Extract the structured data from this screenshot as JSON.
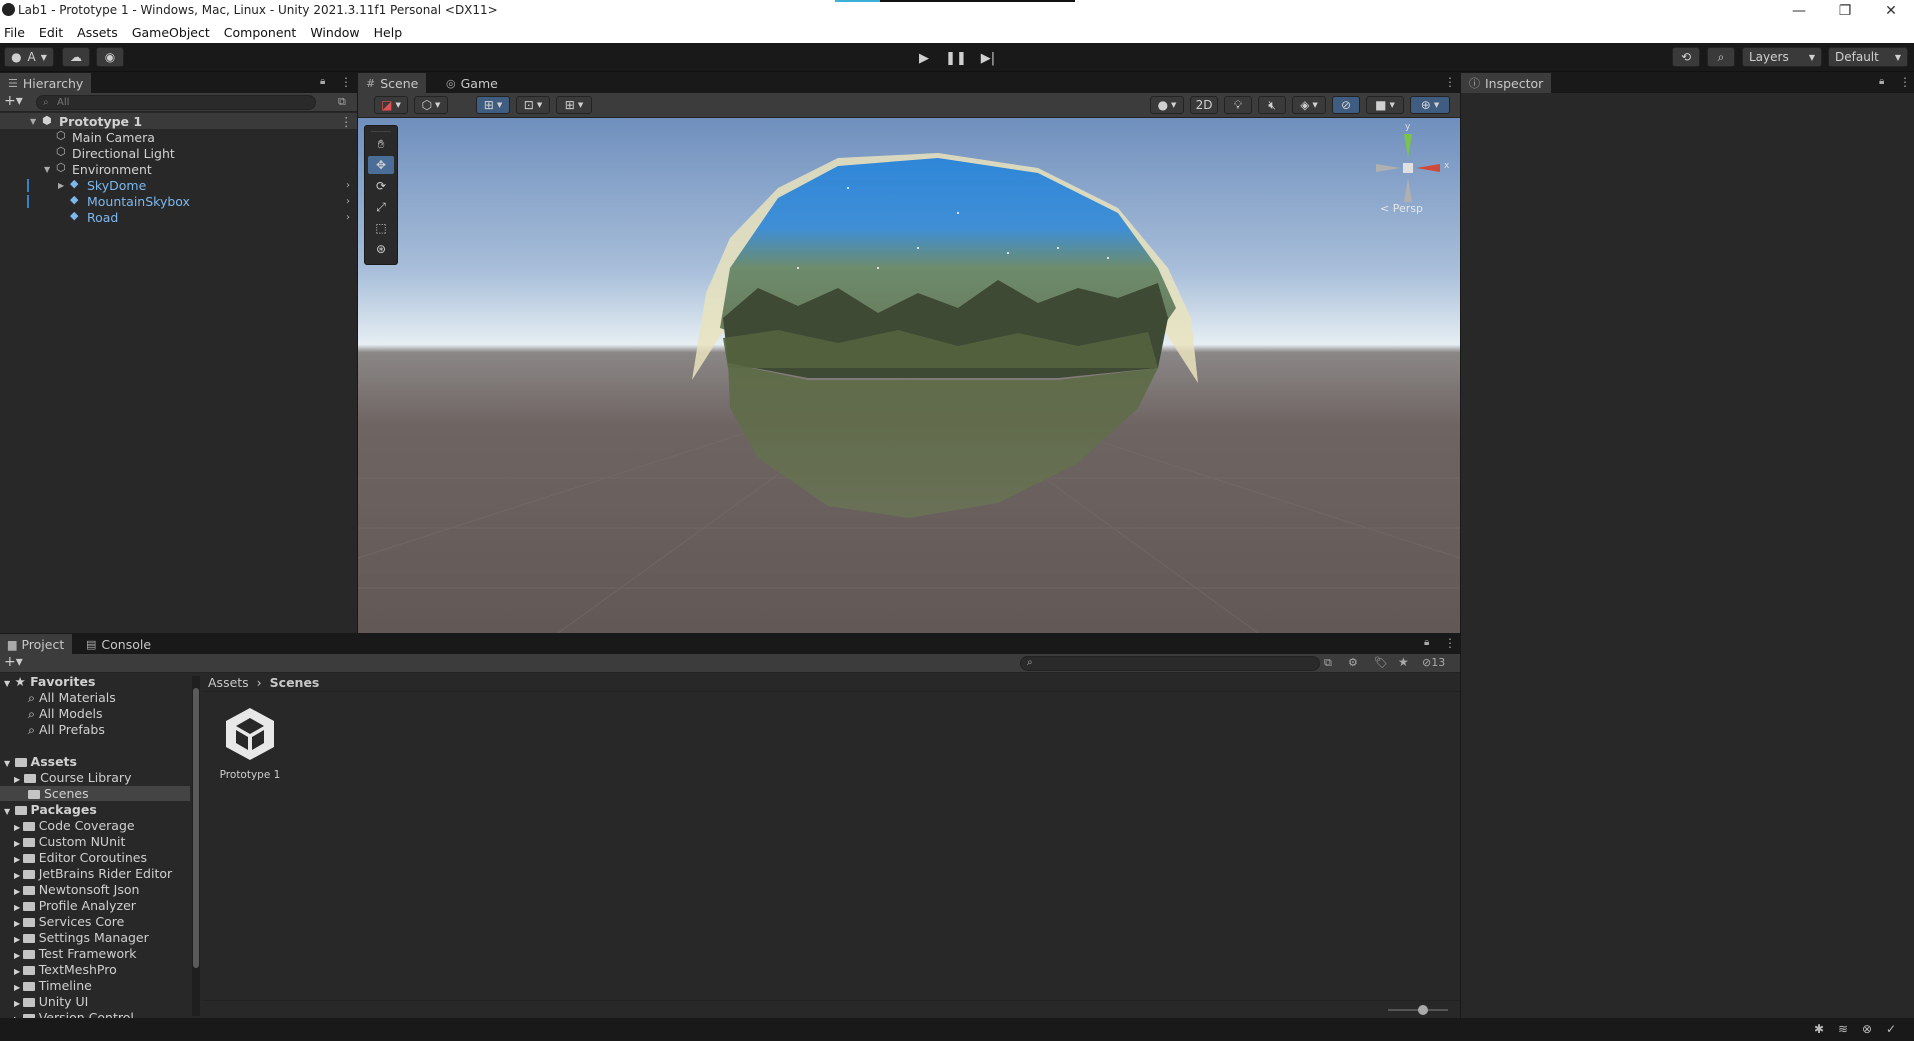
{
  "window": {
    "title": "Lab1 - Prototype 1 - Windows, Mac, Linux - Unity 2021.3.11f1 Personal <DX11>",
    "controls": [
      "—",
      "❐",
      "✕"
    ]
  },
  "menu": [
    "File",
    "Edit",
    "Assets",
    "GameObject",
    "Component",
    "Window",
    "Help"
  ],
  "toolbar": {
    "account_label": "A",
    "layers_label": "Layers",
    "layout_label": "Default"
  },
  "hierarchy": {
    "tab_label": "Hierarchy",
    "search_placeholder": "All",
    "items": [
      {
        "label": "Prototype 1"
      },
      {
        "label": "Main Camera"
      },
      {
        "label": "Directional Light"
      },
      {
        "label": "Environment"
      },
      {
        "label": "SkyDome"
      },
      {
        "label": "MountainSkybox"
      },
      {
        "label": "Road"
      }
    ]
  },
  "scene": {
    "tabs": [
      "Scene",
      "Game"
    ],
    "toggle_2d": "2D",
    "gizmo": {
      "y": "y",
      "x": "x",
      "projection": "< Persp"
    }
  },
  "inspector": {
    "tab_label": "Inspector"
  },
  "project": {
    "tabs": [
      "Project",
      "Console"
    ],
    "favorites_label": "Favorites",
    "favorites": [
      "All Materials",
      "All Models",
      "All Prefabs"
    ],
    "assets_label": "Assets",
    "assets": [
      "Course Library",
      "Scenes"
    ],
    "packages_label": "Packages",
    "packages": [
      "Code Coverage",
      "Custom NUnit",
      "Editor Coroutines",
      "JetBrains Rider Editor",
      "Newtonsoft Json",
      "Profile Analyzer",
      "Services Core",
      "Settings Manager",
      "Test Framework",
      "TextMeshPro",
      "Timeline",
      "Unity UI",
      "Version Control"
    ],
    "breadcrumb": [
      "Assets",
      "Scenes"
    ],
    "hidden_count": "13",
    "files": [
      {
        "label": "Prototype 1"
      }
    ]
  }
}
